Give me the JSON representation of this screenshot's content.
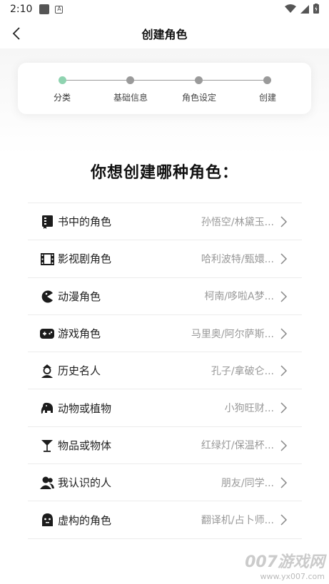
{
  "status_bar": {
    "time": "2:10"
  },
  "header": {
    "title": "创建角色"
  },
  "steps": [
    {
      "label": "分类",
      "active": true
    },
    {
      "label": "基础信息",
      "active": false
    },
    {
      "label": "角色设定",
      "active": false
    },
    {
      "label": "创建",
      "active": false
    }
  ],
  "question": "你想创建哪种角色：",
  "categories": [
    {
      "label": "书中的角色",
      "examples": "孙悟空/林黛玉...",
      "icon": "book-icon"
    },
    {
      "label": "影视剧角色",
      "examples": "哈利波特/甄嬛...",
      "icon": "film-icon"
    },
    {
      "label": "动漫角色",
      "examples": "柯南/哆啦A梦...",
      "icon": "pacman-icon"
    },
    {
      "label": "游戏角色",
      "examples": "马里奥/阿尔萨斯...",
      "icon": "gamepad-icon"
    },
    {
      "label": "历史名人",
      "examples": "孔子/拿破仑...",
      "icon": "historical-figure-icon"
    },
    {
      "label": "动物或植物",
      "examples": "小狗旺财...",
      "icon": "elephant-icon"
    },
    {
      "label": "物品或物体",
      "examples": "红绿灯/保温杯...",
      "icon": "cocktail-glass-icon"
    },
    {
      "label": "我认识的人",
      "examples": "朋友/同学...",
      "icon": "people-icon"
    },
    {
      "label": "虚构的角色",
      "examples": "翻译机/占卜师...",
      "icon": "ghost-icon"
    }
  ],
  "watermark": {
    "main": "007游戏网",
    "url": "www.yx007.com"
  },
  "colors": {
    "active_step": "#8fd3b0",
    "inactive_step": "#9a9a9a"
  }
}
